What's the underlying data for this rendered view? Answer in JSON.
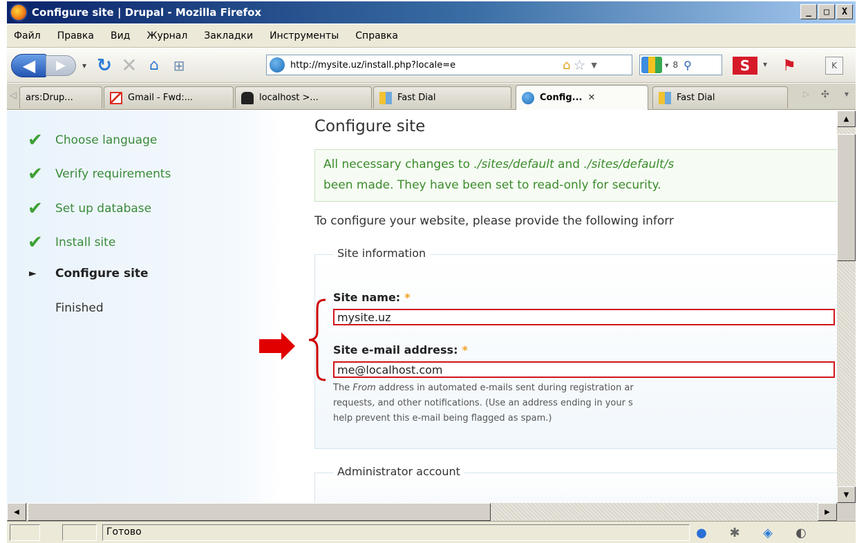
{
  "window": {
    "title": "Configure site | Drupal - Mozilla Firefox",
    "buttons": {
      "minimize": "_",
      "maximize": "□",
      "close": "X"
    }
  },
  "menu": [
    "Файл",
    "Правка",
    "Вид",
    "Журнал",
    "Закладки",
    "Инструменты",
    "Справка"
  ],
  "nav": {
    "url": "http://mysite.uz/install.php?locale=e",
    "search_text": "8",
    "extra_button": "K"
  },
  "tabs": [
    {
      "label": "ars:Drup...",
      "icon": "none"
    },
    {
      "label": "Gmail - Fwd:...",
      "icon": "gmail-icon"
    },
    {
      "label": "localhost >...",
      "icon": "hat-icon"
    },
    {
      "label": "Fast Dial",
      "icon": "fast-dial-icon"
    },
    {
      "label": "Config...",
      "icon": "drupal-icon",
      "active": true
    },
    {
      "label": "Fast Dial",
      "icon": "fast-dial-icon"
    }
  ],
  "sidebar": {
    "steps": [
      {
        "label": "Choose language",
        "state": "done"
      },
      {
        "label": "Verify requirements",
        "state": "done"
      },
      {
        "label": "Set up database",
        "state": "done"
      },
      {
        "label": "Install site",
        "state": "done"
      },
      {
        "label": "Configure site",
        "state": "current"
      },
      {
        "label": "Finished",
        "state": "future"
      }
    ]
  },
  "main": {
    "title": "Configure site",
    "status": {
      "line1_prefix": "All necessary changes to ",
      "path1": "./sites/default",
      "line1_mid": " and ",
      "path2": "./sites/default/s",
      "line2": "been made. They have been set to read-only for security."
    },
    "intro": "To configure your website, please provide the following inforr",
    "site_info": {
      "legend": "Site information",
      "name_label": "Site name:",
      "name_value": "mysite.uz",
      "email_label": "Site e-mail address:",
      "email_value": "me@localhost.com",
      "required_mark": "*",
      "desc_prefix": "The ",
      "desc_from": "From",
      "desc_line1_rest": " address in automated e-mails sent during registration ar",
      "desc_line2": "requests, and other notifications. (Use an address ending in your s",
      "desc_line3": "help prevent this e-mail being flagged as spam.)"
    },
    "admin": {
      "legend": "Administrator account"
    }
  },
  "statusbar": {
    "text": "Готово"
  },
  "colors": {
    "annotation": "#e00000",
    "success_green": "#3b8b2a",
    "check_green": "#3da033"
  }
}
